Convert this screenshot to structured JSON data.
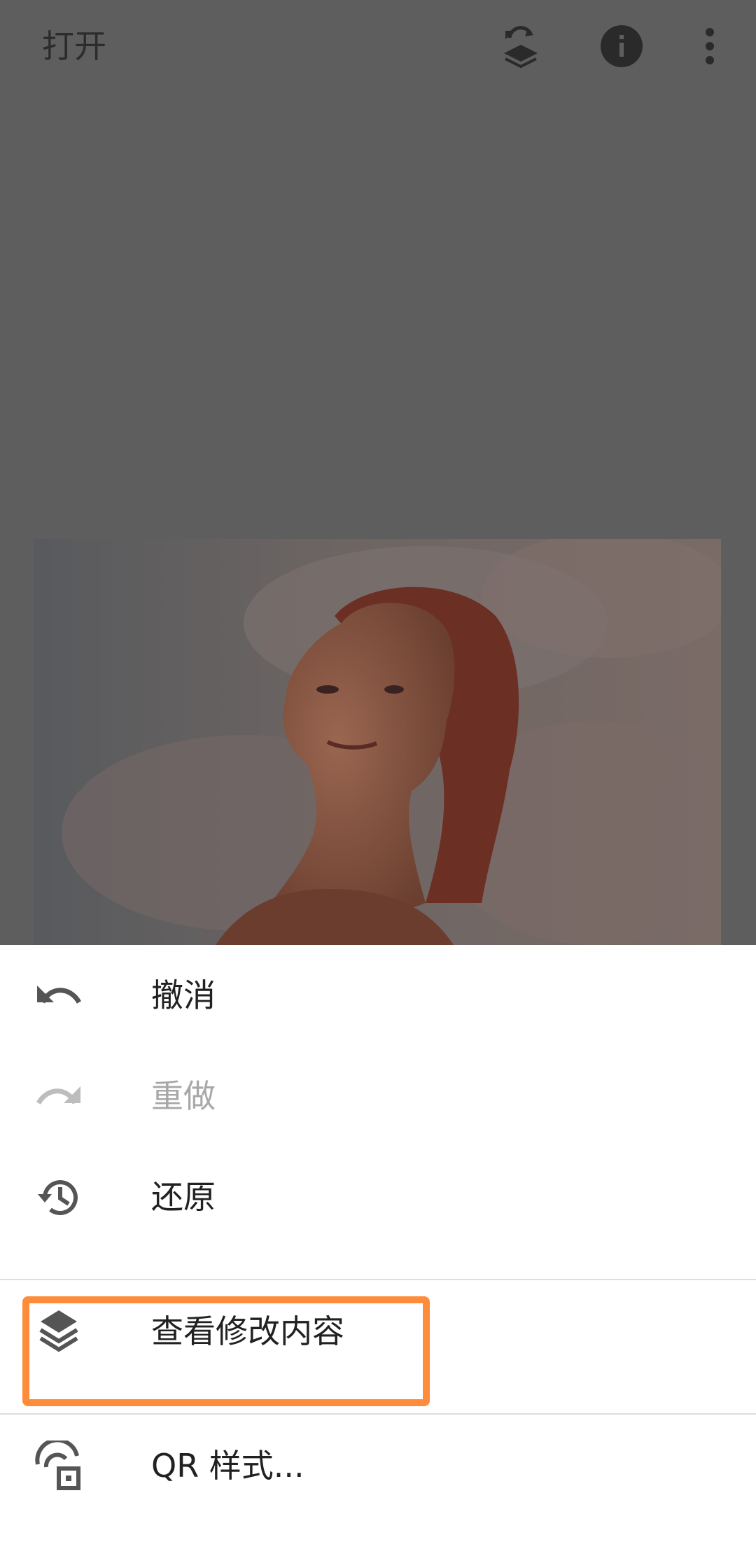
{
  "top_bar": {
    "open_label": "打开",
    "icons": [
      "stack-refresh-icon",
      "info-icon",
      "more-vert-icon"
    ]
  },
  "menu": {
    "items": [
      {
        "label": "撤消",
        "icon": "undo-icon",
        "enabled": true
      },
      {
        "label": "重做",
        "icon": "redo-icon",
        "enabled": false
      },
      {
        "label": "还原",
        "icon": "history-icon",
        "enabled": true
      },
      {
        "label": "查看修改内容",
        "icon": "layers-icon",
        "enabled": true
      },
      {
        "label": "QR 样式...",
        "icon": "qr-style-icon",
        "enabled": true
      }
    ]
  },
  "colors": {
    "dim_background": "#5e5e5e",
    "highlight": "#ff8c3a",
    "text_primary": "#212121",
    "text_disabled": "#a8a8a8"
  }
}
